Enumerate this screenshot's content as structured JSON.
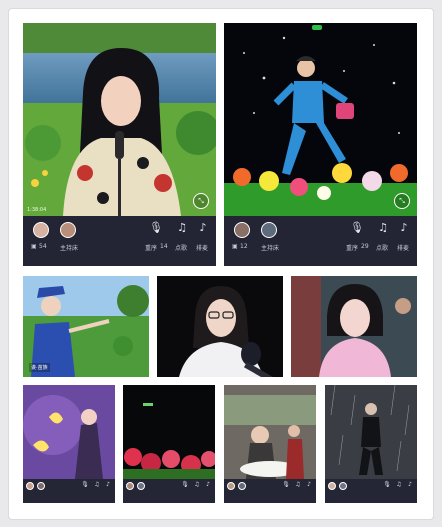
{
  "top_left_card": {
    "duration": "1:38:04",
    "viewer_count": "54",
    "host_label": "主持床",
    "queue_label": "重序",
    "queue_count": "14",
    "order_label": "点歌",
    "rank_label": "排麦"
  },
  "top_right_card": {
    "viewer_count": "12",
    "host_label": "主持床",
    "queue_label": "重序",
    "queue_count": "29",
    "order_label": "点歌",
    "rank_label": "排麦"
  },
  "mid_left": {
    "tag": "诶·苗族"
  },
  "icons": {
    "collapse": "collapse-icon",
    "mic": "mic-icon",
    "music": "music-note-icon",
    "rank": "mic-rank-icon",
    "chat": "chat-icon"
  },
  "colors": {
    "frame_bg": "#ffffff",
    "page_bg": "#e9e9ec",
    "bar_bg": "#232534"
  }
}
